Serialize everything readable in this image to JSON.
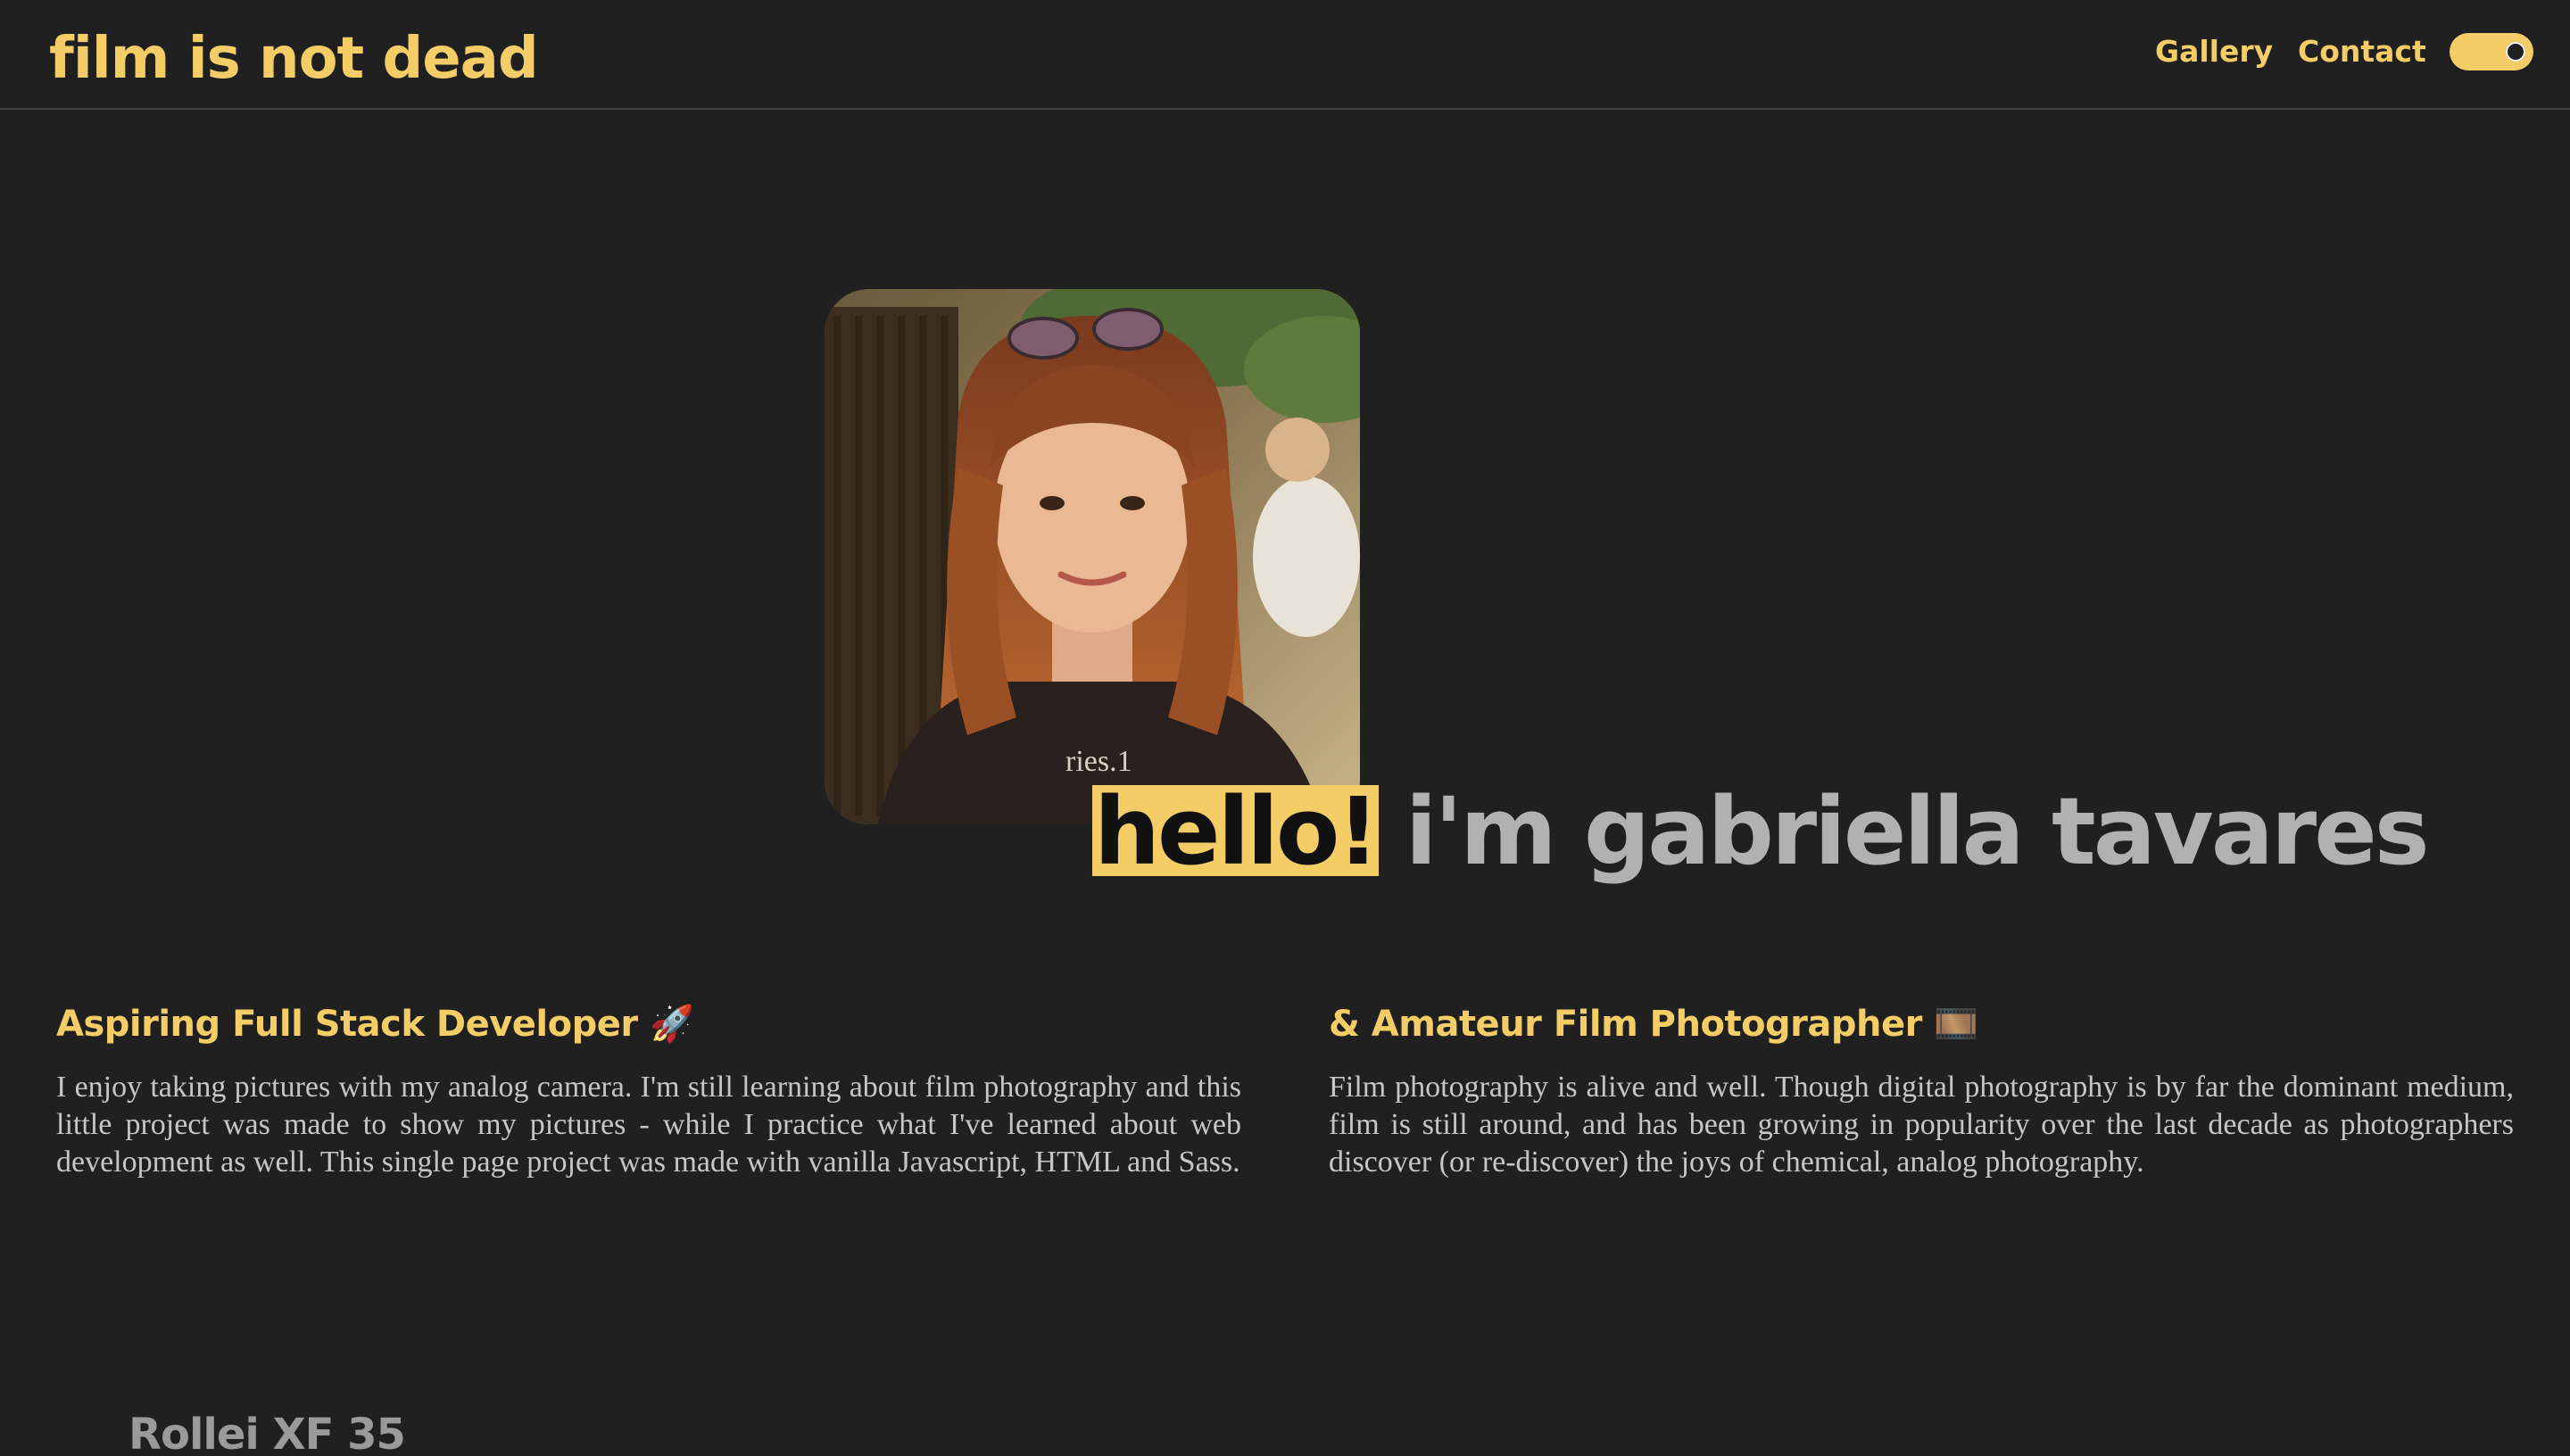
{
  "header": {
    "logo": "film is not dead",
    "nav": {
      "gallery": "Gallery",
      "contact": "Contact"
    },
    "theme_toggle": {
      "state": "on"
    }
  },
  "hero": {
    "highlight": "hello!",
    "name": "i'm gabriella tavares",
    "portrait_printed_text": "ries.1"
  },
  "intro": {
    "left": {
      "heading": "Aspiring Full Stack Developer",
      "emoji": "🚀",
      "text": "I enjoy taking pictures with my analog camera. I'm still learning about film photography and this little project was made to show my pictures - while I practice what I've learned about web development as well. This single page project was made with vanilla Javascript, HTML and Sass."
    },
    "right": {
      "heading": "& Amateur Film Photographer",
      "emoji": "🎞️",
      "text": "Film photography is alive and well. Though digital photography is by far the dominant medium, film is still around, and has been growing in popularity over the last decade as photographers discover (or re-discover) the joys of chemical, analog photography."
    }
  },
  "gallery_section": {
    "title": "Rollei XF 35"
  },
  "colors": {
    "background": "#202020",
    "accent": "#f5cd66",
    "name_text": "#b1b1b1",
    "body_text": "#c6c6c6"
  }
}
